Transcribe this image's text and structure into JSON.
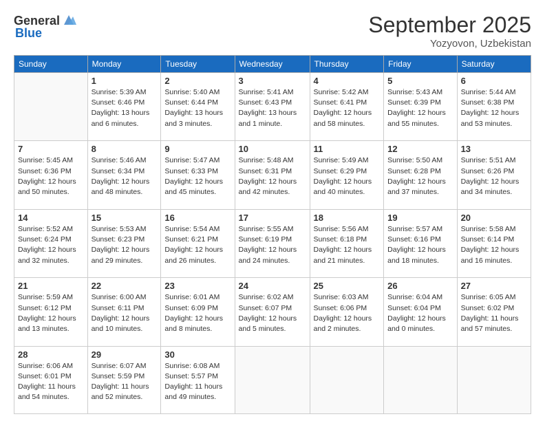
{
  "header": {
    "logo_general": "General",
    "logo_blue": "Blue",
    "title": "September 2025",
    "location": "Yozyovon, Uzbekistan"
  },
  "weekdays": [
    "Sunday",
    "Monday",
    "Tuesday",
    "Wednesday",
    "Thursday",
    "Friday",
    "Saturday"
  ],
  "weeks": [
    [
      {
        "day": "",
        "info": ""
      },
      {
        "day": "1",
        "info": "Sunrise: 5:39 AM\nSunset: 6:46 PM\nDaylight: 13 hours\nand 6 minutes."
      },
      {
        "day": "2",
        "info": "Sunrise: 5:40 AM\nSunset: 6:44 PM\nDaylight: 13 hours\nand 3 minutes."
      },
      {
        "day": "3",
        "info": "Sunrise: 5:41 AM\nSunset: 6:43 PM\nDaylight: 13 hours\nand 1 minute."
      },
      {
        "day": "4",
        "info": "Sunrise: 5:42 AM\nSunset: 6:41 PM\nDaylight: 12 hours\nand 58 minutes."
      },
      {
        "day": "5",
        "info": "Sunrise: 5:43 AM\nSunset: 6:39 PM\nDaylight: 12 hours\nand 55 minutes."
      },
      {
        "day": "6",
        "info": "Sunrise: 5:44 AM\nSunset: 6:38 PM\nDaylight: 12 hours\nand 53 minutes."
      }
    ],
    [
      {
        "day": "7",
        "info": "Sunrise: 5:45 AM\nSunset: 6:36 PM\nDaylight: 12 hours\nand 50 minutes."
      },
      {
        "day": "8",
        "info": "Sunrise: 5:46 AM\nSunset: 6:34 PM\nDaylight: 12 hours\nand 48 minutes."
      },
      {
        "day": "9",
        "info": "Sunrise: 5:47 AM\nSunset: 6:33 PM\nDaylight: 12 hours\nand 45 minutes."
      },
      {
        "day": "10",
        "info": "Sunrise: 5:48 AM\nSunset: 6:31 PM\nDaylight: 12 hours\nand 42 minutes."
      },
      {
        "day": "11",
        "info": "Sunrise: 5:49 AM\nSunset: 6:29 PM\nDaylight: 12 hours\nand 40 minutes."
      },
      {
        "day": "12",
        "info": "Sunrise: 5:50 AM\nSunset: 6:28 PM\nDaylight: 12 hours\nand 37 minutes."
      },
      {
        "day": "13",
        "info": "Sunrise: 5:51 AM\nSunset: 6:26 PM\nDaylight: 12 hours\nand 34 minutes."
      }
    ],
    [
      {
        "day": "14",
        "info": "Sunrise: 5:52 AM\nSunset: 6:24 PM\nDaylight: 12 hours\nand 32 minutes."
      },
      {
        "day": "15",
        "info": "Sunrise: 5:53 AM\nSunset: 6:23 PM\nDaylight: 12 hours\nand 29 minutes."
      },
      {
        "day": "16",
        "info": "Sunrise: 5:54 AM\nSunset: 6:21 PM\nDaylight: 12 hours\nand 26 minutes."
      },
      {
        "day": "17",
        "info": "Sunrise: 5:55 AM\nSunset: 6:19 PM\nDaylight: 12 hours\nand 24 minutes."
      },
      {
        "day": "18",
        "info": "Sunrise: 5:56 AM\nSunset: 6:18 PM\nDaylight: 12 hours\nand 21 minutes."
      },
      {
        "day": "19",
        "info": "Sunrise: 5:57 AM\nSunset: 6:16 PM\nDaylight: 12 hours\nand 18 minutes."
      },
      {
        "day": "20",
        "info": "Sunrise: 5:58 AM\nSunset: 6:14 PM\nDaylight: 12 hours\nand 16 minutes."
      }
    ],
    [
      {
        "day": "21",
        "info": "Sunrise: 5:59 AM\nSunset: 6:12 PM\nDaylight: 12 hours\nand 13 minutes."
      },
      {
        "day": "22",
        "info": "Sunrise: 6:00 AM\nSunset: 6:11 PM\nDaylight: 12 hours\nand 10 minutes."
      },
      {
        "day": "23",
        "info": "Sunrise: 6:01 AM\nSunset: 6:09 PM\nDaylight: 12 hours\nand 8 minutes."
      },
      {
        "day": "24",
        "info": "Sunrise: 6:02 AM\nSunset: 6:07 PM\nDaylight: 12 hours\nand 5 minutes."
      },
      {
        "day": "25",
        "info": "Sunrise: 6:03 AM\nSunset: 6:06 PM\nDaylight: 12 hours\nand 2 minutes."
      },
      {
        "day": "26",
        "info": "Sunrise: 6:04 AM\nSunset: 6:04 PM\nDaylight: 12 hours\nand 0 minutes."
      },
      {
        "day": "27",
        "info": "Sunrise: 6:05 AM\nSunset: 6:02 PM\nDaylight: 11 hours\nand 57 minutes."
      }
    ],
    [
      {
        "day": "28",
        "info": "Sunrise: 6:06 AM\nSunset: 6:01 PM\nDaylight: 11 hours\nand 54 minutes."
      },
      {
        "day": "29",
        "info": "Sunrise: 6:07 AM\nSunset: 5:59 PM\nDaylight: 11 hours\nand 52 minutes."
      },
      {
        "day": "30",
        "info": "Sunrise: 6:08 AM\nSunset: 5:57 PM\nDaylight: 11 hours\nand 49 minutes."
      },
      {
        "day": "",
        "info": ""
      },
      {
        "day": "",
        "info": ""
      },
      {
        "day": "",
        "info": ""
      },
      {
        "day": "",
        "info": ""
      }
    ]
  ]
}
